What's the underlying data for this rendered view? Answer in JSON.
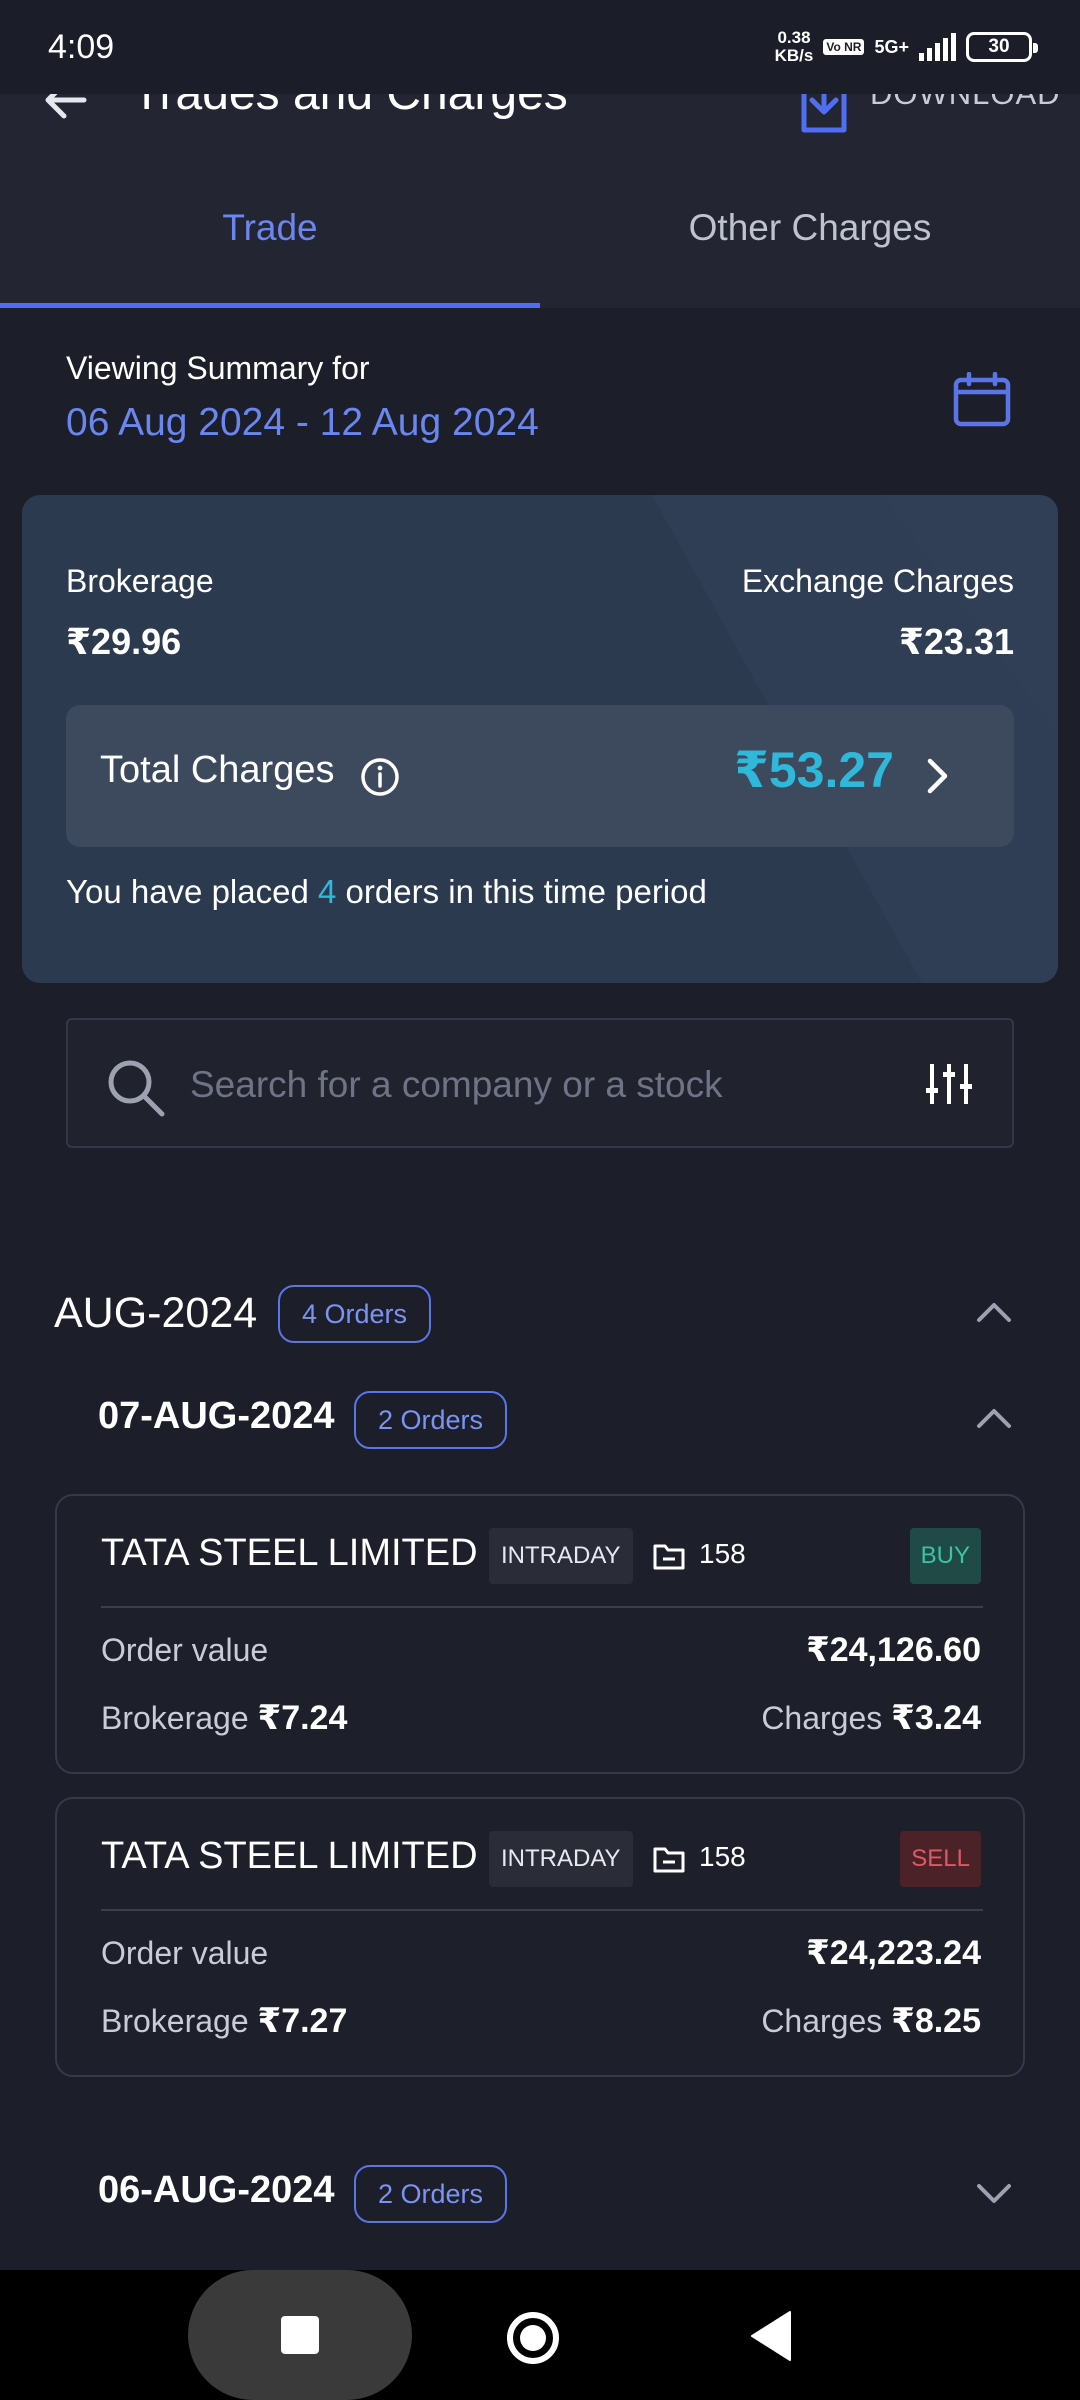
{
  "status_bar": {
    "time": "4:09",
    "speed_value": "0.38",
    "speed_unit": "KB/s",
    "volte": "Vo NR",
    "network": "5G+",
    "battery": "30"
  },
  "header": {
    "title": "Trades and Charges",
    "download_label": "DOWNLOAD"
  },
  "tabs": [
    {
      "label": "Trade",
      "active": true
    },
    {
      "label": "Other Charges",
      "active": false
    }
  ],
  "summary": {
    "label": "Viewing Summary for",
    "date_range": "06 Aug 2024 - 12 Aug 2024"
  },
  "charges": {
    "brokerage_label": "Brokerage",
    "brokerage_value": "₹29.96",
    "exchange_label": "Exchange Charges",
    "exchange_value": "₹23.31",
    "total_label": "Total Charges",
    "total_value": "₹53.27",
    "orders_prefix": "You have placed ",
    "orders_count": "4",
    "orders_suffix": " orders in this time period"
  },
  "search": {
    "placeholder": "Search for a company or a stock"
  },
  "month_group": {
    "title": "AUG-2024",
    "badge": "4 Orders"
  },
  "days": [
    {
      "title": "07-AUG-2024",
      "badge": "2 Orders",
      "trades": [
        {
          "name": "TATA STEEL LIMITED",
          "type": "INTRADAY",
          "qty": "158",
          "side": "BUY",
          "order_value_label": "Order value",
          "order_value": "₹24,126.60",
          "brokerage_label": "Brokerage",
          "brokerage": "₹7.24",
          "charges_label": "Charges",
          "charges": "₹3.24"
        },
        {
          "name": "TATA STEEL LIMITED",
          "type": "INTRADAY",
          "qty": "158",
          "side": "SELL",
          "order_value_label": "Order value",
          "order_value": "₹24,223.24",
          "brokerage_label": "Brokerage",
          "brokerage": "₹7.27",
          "charges_label": "Charges",
          "charges": "₹8.25"
        }
      ]
    },
    {
      "title": "06-AUG-2024",
      "badge": "2 Orders",
      "trades": []
    }
  ],
  "colors": {
    "accent": "#6c86ef",
    "cyan": "#2fb8d9",
    "buy": "#3ec2a6",
    "sell": "#e25862",
    "background": "#1c1f2a"
  }
}
